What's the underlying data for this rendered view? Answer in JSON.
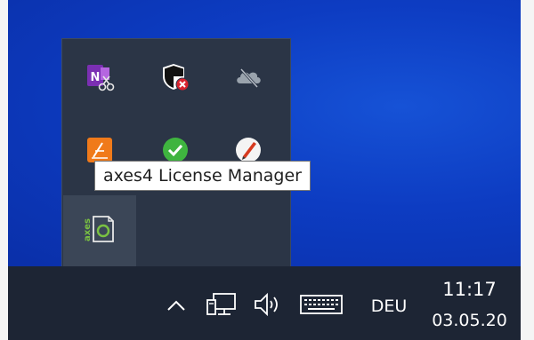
{
  "tray_overflow": {
    "icons": [
      {
        "name": "onenote-send-to-tool-icon"
      },
      {
        "name": "windows-security-alert-icon"
      },
      {
        "name": "onedrive-offline-icon"
      },
      {
        "name": "orange-app-icon"
      },
      {
        "name": "green-checkmark-icon"
      },
      {
        "name": "pen-app-icon"
      },
      {
        "name": "axes4-license-manager-icon"
      }
    ],
    "tooltip": "axes4 License Manager",
    "axes_icon_text": "axes"
  },
  "taskbar": {
    "show_hidden_icons": "^",
    "network_icon": "network-icon",
    "volume_icon": "volume-icon",
    "keyboard_icon": "touch-keyboard-icon",
    "language": "DEU",
    "time": "11:17",
    "date": "03.05.20"
  },
  "colors": {
    "desktop": "#0d3cc2",
    "flyout": "#2b3546",
    "taskbar": "#1d2534",
    "tooltip_bg": "#ffffff"
  }
}
